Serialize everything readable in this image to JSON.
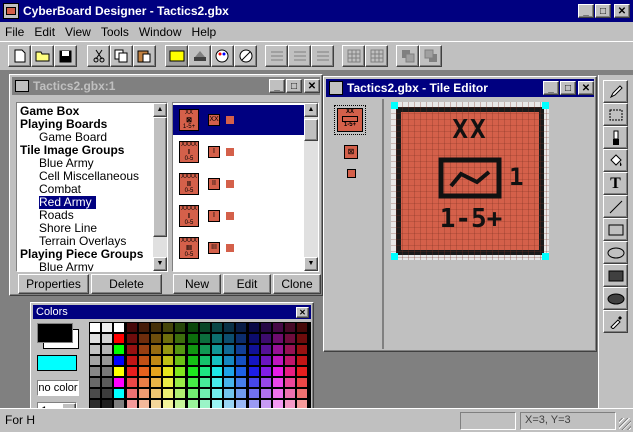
{
  "app": {
    "title": "CyberBoard Designer - Tactics2.gbx"
  },
  "menu": [
    "File",
    "Edit",
    "View",
    "Tools",
    "Window",
    "Help"
  ],
  "gbx_window": {
    "title": "Tactics2.gbx:1",
    "tree": [
      {
        "label": "Game Box",
        "level": 0
      },
      {
        "label": "Playing Boards",
        "level": 0
      },
      {
        "label": "Game Board",
        "level": 1
      },
      {
        "label": "Tile Image Groups",
        "level": 0
      },
      {
        "label": "Blue Army",
        "level": 1
      },
      {
        "label": "Cell Miscellaneous",
        "level": 1
      },
      {
        "label": "Combat",
        "level": 1
      },
      {
        "label": "Red Army",
        "level": 1,
        "selected": true
      },
      {
        "label": "Roads",
        "level": 1
      },
      {
        "label": "Shore Line",
        "level": 1
      },
      {
        "label": "Terrain Overlays",
        "level": 1
      },
      {
        "label": "Playing Piece Groups",
        "level": 0
      },
      {
        "label": "Blue Army",
        "level": 1
      }
    ],
    "properties_button": "Properties",
    "delete_button": "Delete",
    "new_button": "New",
    "edit_button": "Edit",
    "clone_button": "Clone",
    "tiles": [
      {
        "top": "XX",
        "sym": "⊠",
        "bot": "1-5+",
        "mini": "XX",
        "selected": true
      },
      {
        "top": "XXXX",
        "sym": "I",
        "bot": "0-5",
        "mini": "I"
      },
      {
        "top": "XXXX",
        "sym": "II",
        "bot": "0-5",
        "mini": "II"
      },
      {
        "top": "XXXX",
        "sym": "I",
        "bot": "0-5",
        "mini": "I"
      },
      {
        "top": "XXXX",
        "sym": "III",
        "bot": "0-5",
        "mini": "III"
      }
    ]
  },
  "tile_editor": {
    "title": "Tactics2.gbx - Tile Editor",
    "preview_top": "XX",
    "preview_bot": "1-5+",
    "canvas_top": "XX",
    "canvas_side": "1",
    "canvas_bot": "1-5+"
  },
  "colors_palette": {
    "title": "Colors",
    "no_color_label": "no color",
    "line_width_value": "1",
    "fg_color": "#000000",
    "bg_color": "#ffffff",
    "transparent_color": "#00ffff"
  },
  "status_bar": {
    "text": "For H",
    "coords": "X=3, Y=3"
  },
  "colors": {
    "accent": "#000080",
    "tile_red": "#d4604a",
    "canvas_bg": "#ffffff"
  }
}
